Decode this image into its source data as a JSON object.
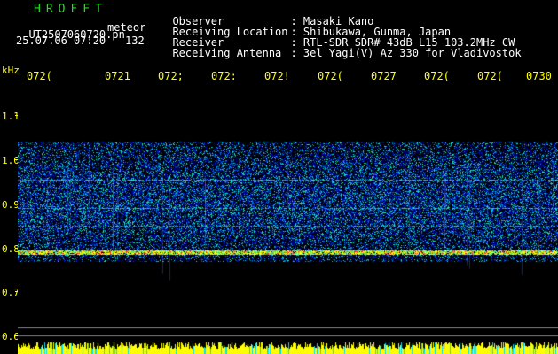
{
  "header": {
    "brand": "HROFFT",
    "filename": "UT2507060720.pn",
    "tag": "meteor",
    "timestamp": "25.07.06 07:20",
    "count": "132"
  },
  "metadata": [
    {
      "key": "Observer",
      "value": ": Masaki Kano"
    },
    {
      "key": "Receiving Location",
      "value": ": Shibukawa, Gunma, Japan"
    },
    {
      "key": "Receiver",
      "value": ": RTL-SDR SDR# 43dB L15 103.2MHz CW"
    },
    {
      "key": "Receiving Antenna",
      "value": ": 3el Yagi(V) Az 330 for Vladivostok"
    }
  ],
  "axis": {
    "y_unit": "kHz",
    "x_ticks": [
      "072(",
      "0721",
      "072;",
      "072:",
      "072!",
      "072(",
      "0727",
      "072(",
      "072(",
      "0730"
    ],
    "y_ticks": [
      "1.1",
      "1.0",
      "0.9",
      "0.8",
      "0.7",
      "0.6"
    ]
  },
  "colors": {
    "background": "#000000",
    "text": "#ffffff",
    "brand": "#22dd22",
    "axis": "#ffff00",
    "spectrum_low": "#1010c0",
    "spectrum_mid": "#00c0ff",
    "spectrum_high": "#ffff00",
    "spectrum_peak": "#ff2020"
  }
}
